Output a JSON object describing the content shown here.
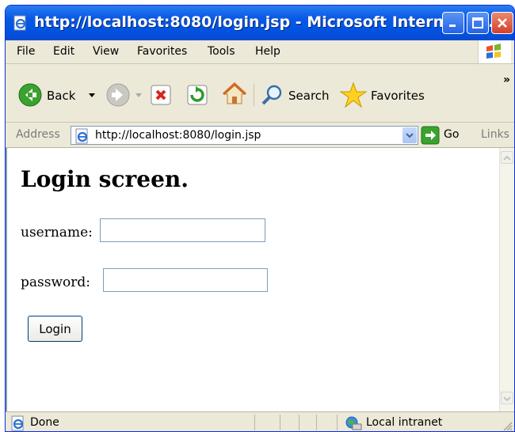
{
  "window": {
    "title": "http://localhost:8080/login.jsp - Microsoft Internet E..."
  },
  "menu": {
    "items": [
      "File",
      "Edit",
      "View",
      "Favorites",
      "Tools",
      "Help"
    ]
  },
  "toolbar": {
    "back_label": "Back",
    "search_label": "Search",
    "favorites_label": "Favorites",
    "chevron": "»"
  },
  "address": {
    "label": "Address",
    "url": "http://localhost:8080/login.jsp",
    "go_label": "Go",
    "links_label": "Links"
  },
  "page": {
    "heading": "Login screen.",
    "username_label": "username:",
    "username_value": "",
    "password_label": "password:",
    "password_value": "",
    "login_button": "Login"
  },
  "status": {
    "text": "Done",
    "zone": "Local intranet"
  },
  "colors": {
    "titlebar": "#0053e1",
    "chrome": "#ece9d8",
    "input_border": "#7f9db9"
  }
}
